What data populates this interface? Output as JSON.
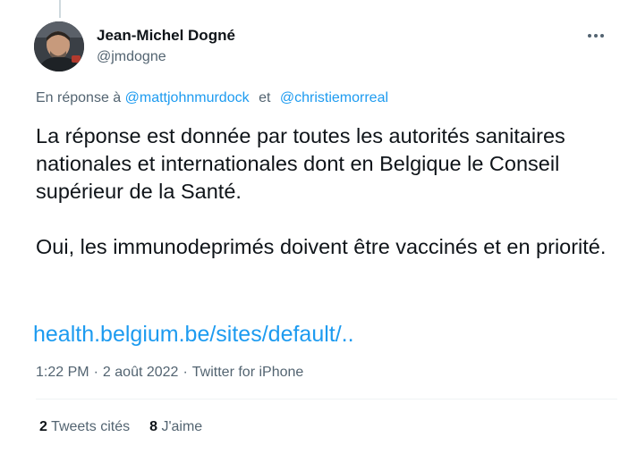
{
  "author": {
    "display_name": "Jean-Michel Dogné",
    "handle": "@jmdogne"
  },
  "reply_context": {
    "prefix": "En réponse à",
    "mention_1": "@mattjohnmurdock",
    "conjunction": "et",
    "mention_2": "@christiemorreal"
  },
  "tweet": {
    "paragraph_1": "La réponse est donnée par toutes les autorités sanitaires nationales et internationales dont en Belgique le Conseil supérieur de la Santé.",
    "paragraph_2": "Oui, les immunodeprimés doivent être vaccinés et en priorité.",
    "link": "health.belgium.be/sites/default/.."
  },
  "meta": {
    "time": "1:22 PM",
    "separator": "·",
    "date": "2 août 2022",
    "source": "Twitter for iPhone"
  },
  "stats": {
    "quote_count": "2",
    "quote_label": "Tweets cités",
    "like_count": "8",
    "like_label": "J'aime"
  },
  "icons": {
    "more": "more-horizontal-icon",
    "avatar": "profile-photo"
  },
  "colors": {
    "accent": "#1d9bf0",
    "text_primary": "#0f1419",
    "text_secondary": "#536471",
    "divider": "#eff3f4"
  }
}
